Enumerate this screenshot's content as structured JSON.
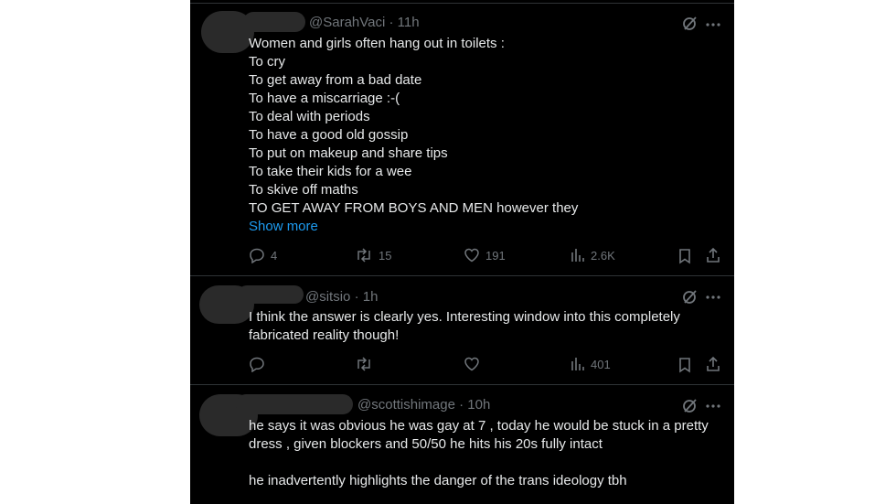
{
  "tweets": [
    {
      "handle": "@SarahVaci · 11h",
      "lines": [
        "Women and girls often hang out in toilets :",
        "To cry",
        "To get away from a bad date",
        "To have a miscarriage :-(",
        "To deal with periods",
        "To have a good old gossip",
        "To put on makeup and share tips",
        "To take their kids for a wee",
        "To skive off maths",
        "TO GET AWAY FROM BOYS AND MEN however they"
      ],
      "show_more": "Show more",
      "replies": "4",
      "reposts": "15",
      "likes": "191",
      "views": "2.6K"
    },
    {
      "handle": "@sitsio · 1h",
      "lines": [
        "I think the answer is clearly yes. Interesting window into this completely",
        "fabricated reality though!"
      ],
      "replies": "",
      "reposts": "",
      "likes": "",
      "views": "401"
    },
    {
      "handle": "@scottishimage · 10h",
      "lines": [
        "he says it was obvious he was gay at 7 , today he would be stuck in a pretty",
        "dress , given blockers and 50/50 he hits his 20s fully intact",
        "",
        "he inadvertently highlights the danger of the trans ideology tbh"
      ]
    }
  ],
  "icons": {
    "grok": "grok-icon",
    "more": "more-icon",
    "reply": "reply-icon",
    "repost": "repost-icon",
    "like": "like-icon",
    "views": "views-icon",
    "bookmark": "bookmark-icon",
    "share": "share-icon"
  },
  "colors": {
    "background": "#000000",
    "text": "#e7e9ea",
    "secondary": "#71767b",
    "link": "#1d9bf0",
    "divider": "#2f3336"
  }
}
